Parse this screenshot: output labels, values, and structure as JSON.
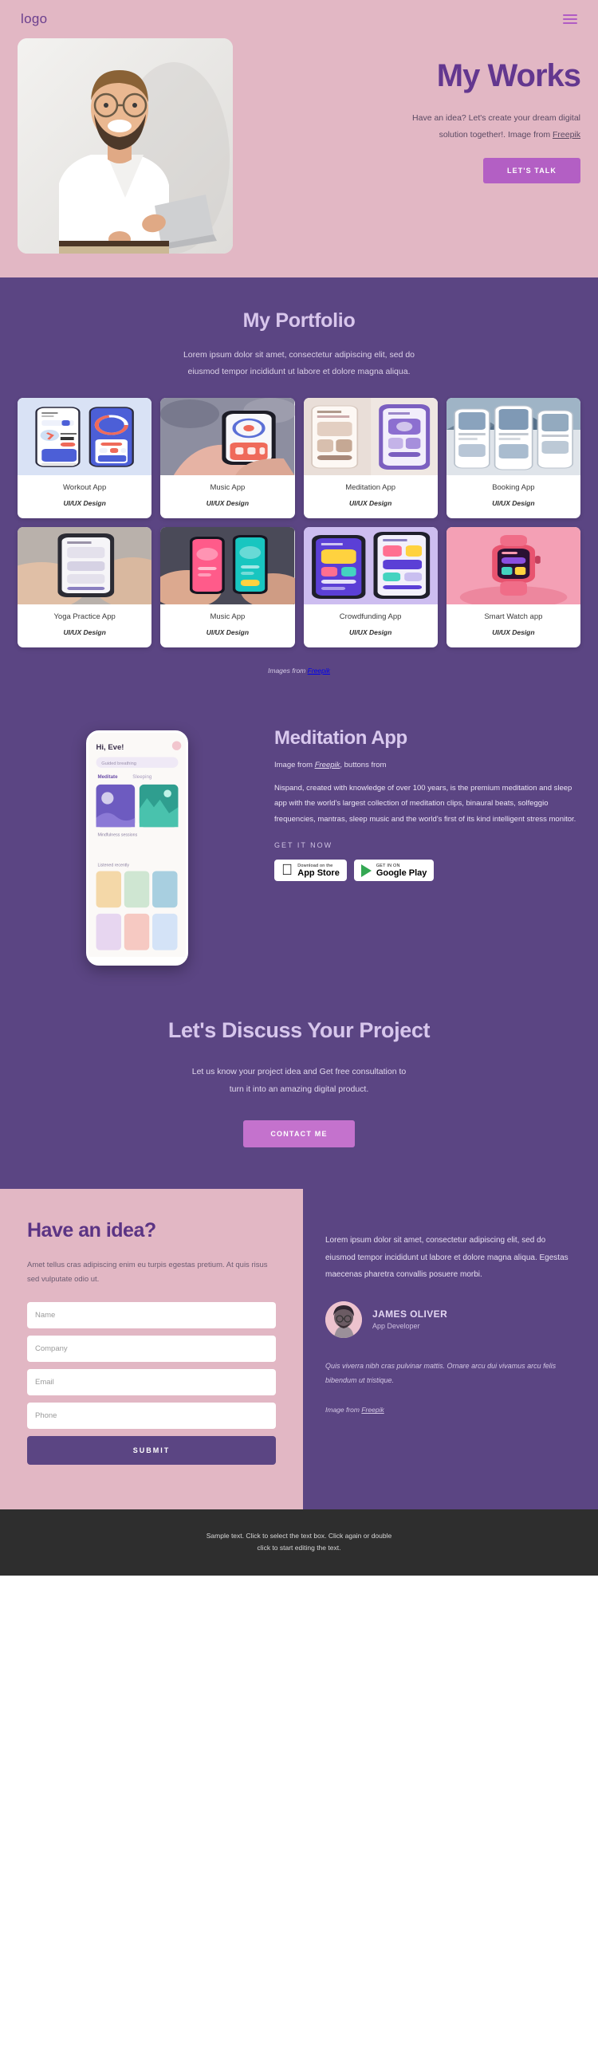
{
  "brand": {
    "logo": "logo",
    "accent_purple": "#5b4583",
    "accent_pink": "#e2b7c4",
    "accent_magenta": "#b35fc4"
  },
  "hero": {
    "title": "My Works",
    "subtitle_line1": "Have an idea? Let's create your dream digital",
    "subtitle_line2": "solution together!.  Image from ",
    "subtitle_link": "Freepik",
    "cta": "LET'S TALK",
    "menu_icon": "hamburger-menu-icon"
  },
  "portfolio": {
    "title": "My Portfolio",
    "subtitle_line1": "Lorem ipsum dolor sit amet, consectetur adipiscing elit, sed do",
    "subtitle_line2": "eiusmod tempor incididunt ut labore et dolore magna aliqua.",
    "cards": [
      {
        "title": "Workout App",
        "category": "UI/UX Design"
      },
      {
        "title": "Music App",
        "category": "UI/UX Design"
      },
      {
        "title": "Meditation App",
        "category": "UI/UX Design"
      },
      {
        "title": "Booking  App",
        "category": "UI/UX Design"
      },
      {
        "title": "Yoga Practice App",
        "category": "UI/UX Design"
      },
      {
        "title": "Music App",
        "category": "UI/UX Design"
      },
      {
        "title": "Crowdfunding App",
        "category": "UI/UX Design"
      },
      {
        "title": "Smart Watch app",
        "category": "UI/UX Design"
      }
    ],
    "credit_prefix": "Images from ",
    "credit_link": "Freepik"
  },
  "meditation": {
    "title": "Meditation App",
    "credit_prefix": "Image from ",
    "credit_link": "Freepik",
    "credit_suffix": ", buttons from",
    "body": "Nispand, created with knowledge of over 100 years, is the premium meditation and sleep app with the world's largest collection of meditation clips, binaural beats, solfeggio frequencies, mantras, sleep music and the world's first of its kind intelligent stress monitor.",
    "get_it_now": "GET IT NOW",
    "stores": [
      {
        "small": "Download on the",
        "big": "App Store",
        "icon": "apple-icon"
      },
      {
        "small": "GET IN ON",
        "big": "Google Play",
        "icon": "google-play-icon"
      }
    ],
    "phone_screen": {
      "greeting": "Hi, Eve!",
      "search_placeholder": "Guided breathing",
      "tabs": [
        "Meditate",
        "Sleeping"
      ],
      "section1": "Mindfulness sessions",
      "section2": "Listened recently"
    }
  },
  "discuss": {
    "title": "Let's Discuss Your Project",
    "subtitle_line1": "Let us know your project idea and Get free consultation to",
    "subtitle_line2": "turn it into an amazing digital product.",
    "cta": "CONTACT ME"
  },
  "idea": {
    "title": "Have an idea?",
    "subtitle": "Amet tellus cras adipiscing enim eu turpis egestas pretium. At quis risus sed vulputate odio ut.",
    "fields": [
      {
        "name": "name",
        "placeholder": "Name",
        "value": ""
      },
      {
        "name": "company",
        "placeholder": "Company",
        "value": ""
      },
      {
        "name": "email",
        "placeholder": "Email",
        "value": ""
      },
      {
        "name": "phone",
        "placeholder": "Phone",
        "value": ""
      }
    ],
    "submit": "SUBMIT"
  },
  "testimonial": {
    "quote": "Lorem ipsum dolor sit amet, consectetur adipiscing elit, sed do eiusmod tempor incididunt ut labore et dolore magna aliqua. Egestas maecenas pharetra convallis posuere morbi.",
    "name": "JAMES OLIVER",
    "role": "App Developer",
    "note": "Quis viverra nibh cras pulvinar mattis. Ornare arcu dui vivamus arcu felis bibendum ut tristique.",
    "credit_prefix": "Image from ",
    "credit_link": "Freepik"
  },
  "footer": {
    "text_line1": "Sample text. Click to select the text box. Click again or double",
    "text_line2": "click to start editing the text."
  }
}
